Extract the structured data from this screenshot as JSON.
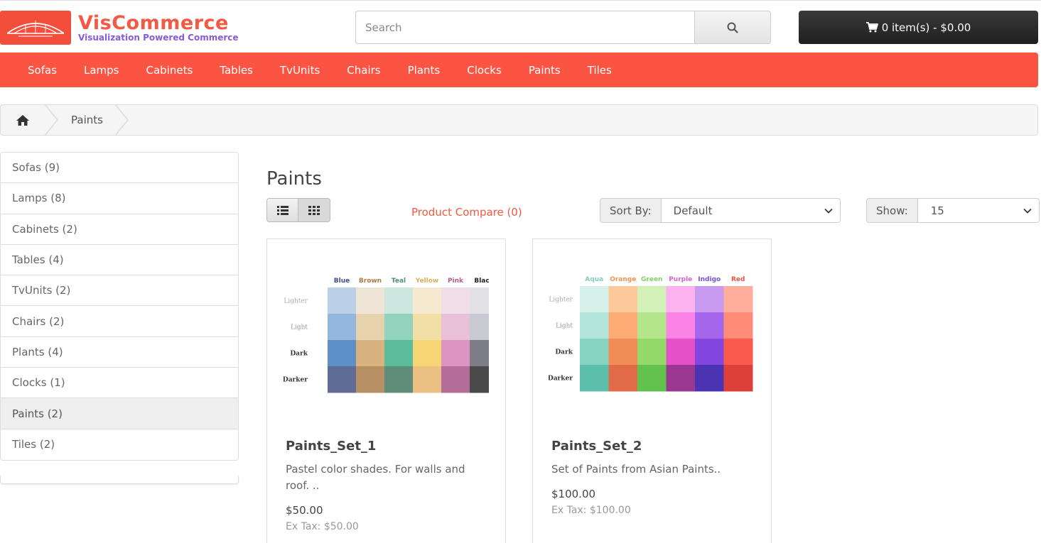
{
  "header": {
    "brand": "VisCommerce",
    "tagline": "Visualization Powered Commerce",
    "search_placeholder": "Search",
    "cart_label": "0 item(s) - $0.00"
  },
  "nav": [
    "Sofas",
    "Lamps",
    "Cabinets",
    "Tables",
    "TvUnits",
    "Chairs",
    "Plants",
    "Clocks",
    "Paints",
    "Tiles"
  ],
  "breadcrumb": {
    "current": "Paints"
  },
  "sidebar": [
    {
      "label": "Sofas (9)",
      "active": false
    },
    {
      "label": "Lamps (8)",
      "active": false
    },
    {
      "label": "Cabinets (2)",
      "active": false
    },
    {
      "label": "Tables (4)",
      "active": false
    },
    {
      "label": "TvUnits (2)",
      "active": false
    },
    {
      "label": "Chairs (2)",
      "active": false
    },
    {
      "label": "Plants (4)",
      "active": false
    },
    {
      "label": "Clocks (1)",
      "active": false
    },
    {
      "label": "Paints (2)",
      "active": true
    },
    {
      "label": "Tiles (2)",
      "active": false
    }
  ],
  "main": {
    "title": "Paints",
    "compare": "Product Compare (0)",
    "sort_label": "Sort By:",
    "sort_value": "Default",
    "show_label": "Show:",
    "show_value": "15"
  },
  "products": [
    {
      "name": "Paints_Set_1",
      "desc": "Pastel color shades. For walls and roof. ..",
      "price": "$50.00",
      "tax": "Ex Tax: $50.00",
      "swatch": {
        "columns": [
          "Blue",
          "Brown",
          "Teal",
          "Yellow",
          "Pink",
          "Black"
        ],
        "column_colors": [
          "#3f4f86",
          "#b07a44",
          "#4c8f7e",
          "#d8b25a",
          "#b05d8e",
          "#222222"
        ],
        "rows": [
          "Lighter",
          "Light",
          "Dark",
          "Darker"
        ],
        "cells": [
          [
            "#bcd0e7",
            "#efe5d6",
            "#cde6df",
            "#f5e9cf",
            "#efdde8",
            "#e2e2e6"
          ],
          [
            "#92b6dd",
            "#e6d3ae",
            "#93d3bd",
            "#f1dfa6",
            "#e8c1d9",
            "#c9c9d1"
          ],
          [
            "#5f8fc9",
            "#d9b37f",
            "#5abc9a",
            "#f5d574",
            "#de94c0",
            "#7d7d87"
          ],
          [
            "#5f6c96",
            "#b69064",
            "#5f8d7a",
            "#ebc082",
            "#b46c99",
            "#4a4a4a"
          ]
        ]
      }
    },
    {
      "name": "Paints_Set_2",
      "desc": "Set of Paints from Asian Paints..",
      "price": "$100.00",
      "tax": "Ex Tax: $100.00",
      "swatch": {
        "columns": [
          "Aqua",
          "Orange",
          "Green",
          "Purple",
          "Indigo",
          "Red"
        ],
        "column_colors": [
          "#7fcfc0",
          "#f0924f",
          "#84cf6a",
          "#d861d8",
          "#7a4fd8",
          "#e8553f"
        ],
        "rows": [
          "Lighter",
          "Light",
          "Dark",
          "Darker"
        ],
        "cells": [
          [
            "#d6f1ea",
            "#fdc99b",
            "#d3f0b8",
            "#fbb2ee",
            "#c99bf0",
            "#ffad9d"
          ],
          [
            "#b3e5dc",
            "#fdab74",
            "#b3e68a",
            "#fc83e6",
            "#a566ec",
            "#ff8c79"
          ],
          [
            "#86d3c2",
            "#f28c56",
            "#93da6b",
            "#e450c7",
            "#8347df",
            "#fa5a4d"
          ],
          [
            "#5cbfab",
            "#e26b49",
            "#62c24e",
            "#9a3790",
            "#4b34b2",
            "#dd3f3a"
          ]
        ]
      }
    }
  ]
}
